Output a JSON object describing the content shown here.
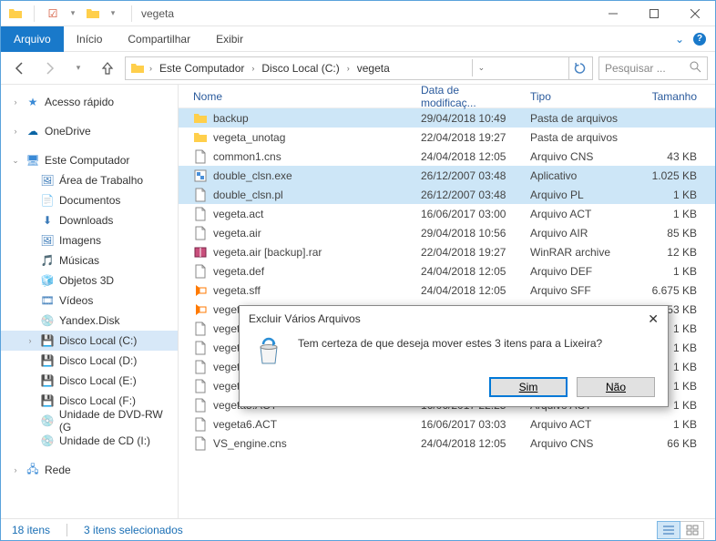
{
  "titlebar": {
    "title": "vegeta"
  },
  "ribbon": {
    "file": "Arquivo",
    "tabs": [
      "Início",
      "Compartilhar",
      "Exibir"
    ]
  },
  "breadcrumb": {
    "items": [
      "Este Computador",
      "Disco Local (C:)",
      "vegeta"
    ]
  },
  "search": {
    "placeholder": "Pesquisar ..."
  },
  "sidebar": {
    "quick_access": "Acesso rápido",
    "onedrive": "OneDrive",
    "this_pc": "Este Computador",
    "children": [
      "Área de Trabalho",
      "Documentos",
      "Downloads",
      "Imagens",
      "Músicas",
      "Objetos 3D",
      "Vídeos",
      "Yandex.Disk",
      "Disco Local (C:)",
      "Disco Local (D:)",
      "Disco Local (E:)",
      "Disco Local (F:)",
      "Unidade de DVD-RW (G",
      "Unidade de CD (I:)"
    ],
    "network": "Rede"
  },
  "columns": {
    "name": "Nome",
    "date": "Data de modificaç...",
    "type": "Tipo",
    "size": "Tamanho"
  },
  "files": [
    {
      "icon": "folder",
      "name": "backup",
      "date": "29/04/2018 10:49",
      "type": "Pasta de arquivos",
      "size": "",
      "selected": true
    },
    {
      "icon": "folder",
      "name": "vegeta_unotag",
      "date": "22/04/2018 19:27",
      "type": "Pasta de arquivos",
      "size": ""
    },
    {
      "icon": "file",
      "name": "common1.cns",
      "date": "24/04/2018 12:05",
      "type": "Arquivo CNS",
      "size": "43 KB"
    },
    {
      "icon": "exe",
      "name": "double_clsn.exe",
      "date": "26/12/2007 03:48",
      "type": "Aplicativo",
      "size": "1.025 KB",
      "selected": true
    },
    {
      "icon": "file",
      "name": "double_clsn.pl",
      "date": "26/12/2007 03:48",
      "type": "Arquivo PL",
      "size": "1 KB",
      "selected": true
    },
    {
      "icon": "file",
      "name": "vegeta.act",
      "date": "16/06/2017 03:00",
      "type": "Arquivo ACT",
      "size": "1 KB"
    },
    {
      "icon": "file",
      "name": "vegeta.air",
      "date": "29/04/2018 10:56",
      "type": "Arquivo AIR",
      "size": "85 KB"
    },
    {
      "icon": "archive",
      "name": "vegeta.air [backup].rar",
      "date": "22/04/2018 19:27",
      "type": "WinRAR archive",
      "size": "12 KB"
    },
    {
      "icon": "file",
      "name": "vegeta.def",
      "date": "24/04/2018 12:05",
      "type": "Arquivo DEF",
      "size": "1 KB"
    },
    {
      "icon": "media",
      "name": "vegeta.sff",
      "date": "24/04/2018 12:05",
      "type": "Arquivo SFF",
      "size": "6.675 KB"
    },
    {
      "icon": "media",
      "name": "vegeta.",
      "date": "",
      "type": "",
      "size": "53 KB"
    },
    {
      "icon": "file",
      "name": "vegeta",
      "date": "",
      "type": "",
      "size": "1 KB"
    },
    {
      "icon": "file",
      "name": "vegeta.",
      "date": "",
      "type": "",
      "size": "1 KB"
    },
    {
      "icon": "file",
      "name": "vegeta.",
      "date": "",
      "type": "",
      "size": "1 KB"
    },
    {
      "icon": "file",
      "name": "vegeta.",
      "date": "",
      "type": "",
      "size": "1 KB"
    },
    {
      "icon": "file",
      "name": "vegeta5.ACT",
      "date": "16/06/2017 22:25",
      "type": "Arquivo ACT",
      "size": "1 KB"
    },
    {
      "icon": "file",
      "name": "vegeta6.ACT",
      "date": "16/06/2017 03:03",
      "type": "Arquivo ACT",
      "size": "1 KB"
    },
    {
      "icon": "file",
      "name": "VS_engine.cns",
      "date": "24/04/2018 12:05",
      "type": "Arquivo CNS",
      "size": "66 KB"
    }
  ],
  "status": {
    "count": "18 itens",
    "selected": "3 itens selecionados"
  },
  "dialog": {
    "title": "Excluir Vários Arquivos",
    "message": "Tem certeza de que deseja mover estes 3 itens para a Lixeira?",
    "yes": "Sim",
    "no": "Não"
  }
}
